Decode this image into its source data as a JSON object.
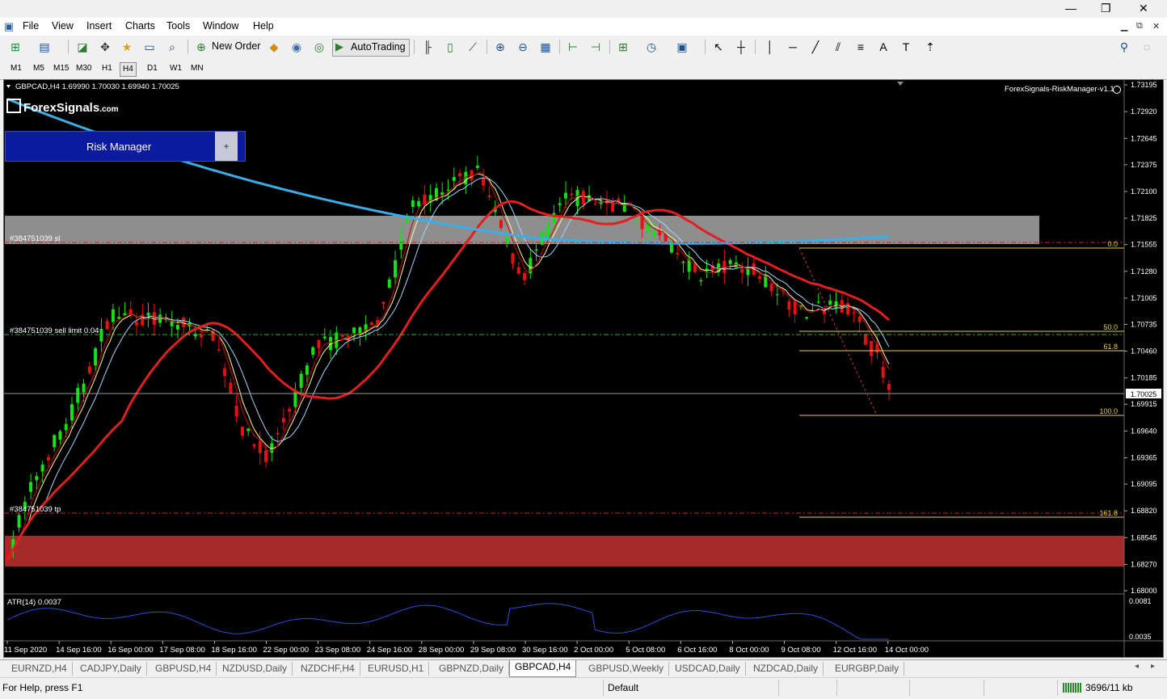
{
  "window": {
    "minimize": "—",
    "maximize": "❐",
    "close": "✕"
  },
  "menu": [
    "File",
    "View",
    "Insert",
    "Charts",
    "Tools",
    "Window",
    "Help"
  ],
  "toolbar": {
    "new_order": "New Order",
    "autotrading": "AutoTrading",
    "text_tool": "A"
  },
  "timeframes": [
    "M1",
    "M5",
    "M15",
    "M30",
    "H1",
    "H4",
    "D1",
    "W1",
    "MN"
  ],
  "active_timeframe": "H4",
  "chart": {
    "header": "GBPCAD,H4  1.69990 1.70030 1.69940 1.70025",
    "indicator_label": "ForexSignals-RiskManager-v1.1",
    "logo_text": "ForexSignals",
    "logo_suffix": ".com",
    "risk_manager_label": "Risk Manager",
    "risk_manager_plus": "+",
    "sl_label": "#384751039 sl",
    "sell_limit_label": "#384751039 sell limit 0.04",
    "tp_label": "#384751039 tp",
    "fib_labels": [
      "0.0",
      "50.0",
      "61.8",
      "100.0",
      "161.8"
    ],
    "current_price": "1.70025",
    "price_ticks": [
      "1.73195",
      "1.72920",
      "1.72645",
      "1.72375",
      "1.72100",
      "1.71825",
      "1.71555",
      "1.71280",
      "1.71005",
      "1.70735",
      "1.70460",
      "1.70185",
      "1.69915",
      "1.69640",
      "1.69365",
      "1.69095",
      "1.68820",
      "1.68545",
      "1.68270",
      "1.68000"
    ],
    "atr_label": "ATR(14) 0.0037",
    "atr_ticks": [
      "0.0081",
      "0.0035"
    ],
    "time_ticks": [
      "11 Sep 2020",
      "14 Sep 16:00",
      "16 Sep 00:00",
      "17 Sep 08:00",
      "18 Sep 16:00",
      "22 Sep 00:00",
      "23 Sep 08:00",
      "24 Sep 16:00",
      "28 Sep 00:00",
      "29 Sep 08:00",
      "30 Sep 16:00",
      "2 Oct 00:00",
      "5 Oct 08:00",
      "6 Oct 16:00",
      "8 Oct 00:00",
      "9 Oct 08:00",
      "12 Oct 16:00",
      "14 Oct 00:00"
    ],
    "colors": {
      "bull": "#16e016",
      "bear": "#e81010",
      "ma_fast": "#c80000",
      "ma_slow": "#e02020",
      "ma_long": "#3aaee8",
      "supply_zone": "#8e8e8e",
      "demand_zone": "#a52a2a",
      "fib": "#e6d13a"
    }
  },
  "tabs": [
    "EURNZD,H4",
    "CADJPY,Daily",
    "GBPUSD,H4",
    "NZDUSD,Daily",
    "NZDCHF,H4",
    "EURUSD,H1",
    "GBPNZD,Daily",
    "GBPCAD,H4",
    "GBPUSD,Weekly",
    "USDCAD,Daily",
    "NZDCAD,Daily",
    "EURGBP,Daily"
  ],
  "active_tab": "GBPCAD,H4",
  "status": {
    "help": "For Help, press F1",
    "profile": "Default",
    "traffic": "3696/11 kb"
  }
}
